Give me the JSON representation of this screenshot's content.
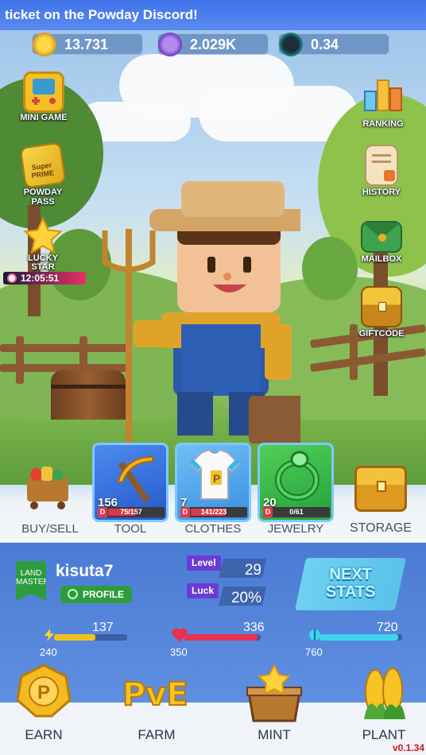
{
  "banner": {
    "text": "ticket on the Powday Discord!"
  },
  "currency": [
    {
      "name": "gold-coin",
      "value": "13.731",
      "icon": "coin-icon",
      "color": "#f2b81f"
    },
    {
      "name": "energy-token",
      "value": "2.029K",
      "icon": "energy-token-icon",
      "color": "#7a45d6"
    },
    {
      "name": "crypto-token",
      "value": "0.34",
      "icon": "crypto-token-icon",
      "color": "#1fa6a4"
    }
  ],
  "left_menu": [
    {
      "label": "MINI GAME",
      "icon": "gameboy-icon"
    },
    {
      "label": "POWDAY\nPASS",
      "icon": "prime-pass-icon"
    },
    {
      "label": "LUCKY\nSTAR",
      "icon": "star-icon"
    }
  ],
  "lucky_star_timer": "12:05:51",
  "right_menu": [
    {
      "label": "RANKING",
      "icon": "ranking-blocks-icon"
    },
    {
      "label": "HISTORY",
      "icon": "scroll-icon"
    },
    {
      "label": "MAILBOX",
      "icon": "envelope-icon"
    },
    {
      "label": "GIFTCODE",
      "icon": "treasure-chest-icon"
    }
  ],
  "equipment": [
    {
      "label": "TOOL",
      "count": "156",
      "durability": "75/157",
      "durability_ratio": 0.48,
      "icon": "pickaxe-icon",
      "color": "#2f6cd8"
    },
    {
      "label": "CLOTHES",
      "count": "7",
      "durability": "141/223",
      "durability_ratio": 0.63,
      "icon": "shirt-icon",
      "color": "#3ea0e8"
    },
    {
      "label": "JEWELRY",
      "count": "20",
      "durability": "0/61",
      "durability_ratio": 0.0,
      "icon": "ring-icon",
      "color": "#2fb04a"
    }
  ],
  "tray": {
    "buy_sell": "BUY/SELL",
    "storage": "STORAGE"
  },
  "profile": {
    "badge": "LAND\nMASTER",
    "username": "kisuta7",
    "profile_button": "PROFILE",
    "level_label": "Level",
    "level": "29",
    "luck_label": "Luck",
    "luck": "20%",
    "next_stats": "NEXT\nSTATS"
  },
  "meters": [
    {
      "name": "energy",
      "current": "137",
      "max": "240",
      "ratio": 0.57,
      "color": "#f2c21f",
      "icon": "lightning-icon"
    },
    {
      "name": "health",
      "current": "336",
      "max": "350",
      "ratio": 0.96,
      "color": "#e8304f",
      "icon": "heart-icon"
    },
    {
      "name": "water",
      "current": "720",
      "max": "760",
      "ratio": 0.95,
      "color": "#3fd4f0",
      "icon": "capsule-icon"
    }
  ],
  "nav": [
    {
      "label": "EARN",
      "icon": "p-coin-icon"
    },
    {
      "label": "FARM",
      "icon": "pve-icon"
    },
    {
      "label": "MINT",
      "icon": "star-crate-icon"
    },
    {
      "label": "PLANT",
      "icon": "corn-icon"
    }
  ],
  "version": "v0.1.34"
}
